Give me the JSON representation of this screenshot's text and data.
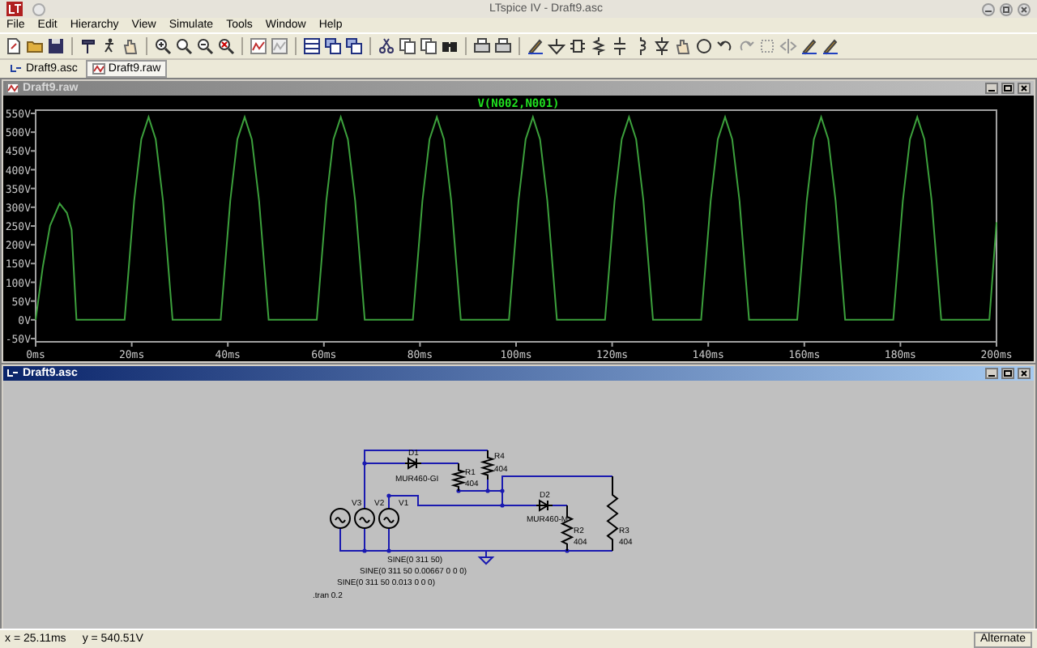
{
  "window": {
    "title": "LTspice IV - Draft9.asc"
  },
  "menu": [
    "File",
    "Edit",
    "Hierarchy",
    "View",
    "Simulate",
    "Tools",
    "Window",
    "Help"
  ],
  "tabs": [
    {
      "label": "Draft9.asc",
      "selected": false
    },
    {
      "label": "Draft9.raw",
      "selected": true
    }
  ],
  "waveform_window": {
    "title": "Draft9.raw",
    "active": false,
    "chart_data": {
      "type": "line",
      "xlim": [
        0,
        200
      ],
      "ylim": [
        -50,
        550
      ],
      "xticks": [
        {
          "value": 0,
          "label": "0ms"
        },
        {
          "value": 20,
          "label": "20ms"
        },
        {
          "value": 40,
          "label": "40ms"
        },
        {
          "value": 60,
          "label": "60ms"
        },
        {
          "value": 80,
          "label": "80ms"
        },
        {
          "value": 100,
          "label": "100ms"
        },
        {
          "value": 120,
          "label": "120ms"
        },
        {
          "value": 140,
          "label": "140ms"
        },
        {
          "value": 160,
          "label": "160ms"
        },
        {
          "value": 180,
          "label": "180ms"
        },
        {
          "value": 200,
          "label": "200ms"
        }
      ],
      "yticks": [
        {
          "value": -50,
          "label": "-50V"
        },
        {
          "value": 0,
          "label": "0V"
        },
        {
          "value": 50,
          "label": "50V"
        },
        {
          "value": 100,
          "label": "100V"
        },
        {
          "value": 150,
          "label": "150V"
        },
        {
          "value": 200,
          "label": "200V"
        },
        {
          "value": 250,
          "label": "250V"
        },
        {
          "value": 300,
          "label": "300V"
        },
        {
          "value": 350,
          "label": "350V"
        },
        {
          "value": 400,
          "label": "400V"
        },
        {
          "value": 450,
          "label": "450V"
        },
        {
          "value": 500,
          "label": "500V"
        },
        {
          "value": 550,
          "label": "550V"
        }
      ],
      "x": [
        0,
        1.5,
        3,
        5,
        6.5,
        7.5,
        8.5,
        18.5,
        20.5,
        22,
        23.5,
        25,
        26.5,
        28.5,
        38.5,
        40.5,
        42,
        43.5,
        45,
        46.5,
        48.5,
        58.5,
        60.5,
        62,
        63.5,
        65,
        66.5,
        68.5,
        78.5,
        80.5,
        82,
        83.5,
        85,
        86.5,
        88.5,
        98.5,
        100.5,
        102,
        103.5,
        105,
        106.5,
        108.5,
        118.5,
        120.5,
        122,
        123.5,
        125,
        126.5,
        128.5,
        138.5,
        140.5,
        142,
        143.5,
        145,
        146.5,
        148.5,
        158.5,
        160.5,
        162,
        163.5,
        165,
        166.5,
        168.5,
        178.5,
        180.5,
        182,
        183.5,
        185,
        186.5,
        188.5,
        198.5,
        200
      ],
      "series": [
        {
          "name": "V(N002,N001)",
          "color": "#3ca03c",
          "values": [
            0,
            141,
            251,
            310,
            285,
            240,
            0,
            0,
            317,
            481,
            540,
            481,
            317,
            0,
            0,
            317,
            481,
            540,
            481,
            317,
            0,
            0,
            317,
            481,
            540,
            481,
            317,
            0,
            0,
            317,
            481,
            540,
            481,
            317,
            0,
            0,
            317,
            481,
            540,
            481,
            317,
            0,
            0,
            317,
            481,
            540,
            481,
            317,
            0,
            0,
            317,
            481,
            540,
            481,
            317,
            0,
            0,
            317,
            481,
            540,
            481,
            317,
            0,
            0,
            317,
            481,
            540,
            481,
            317,
            0,
            0,
            260
          ]
        }
      ]
    }
  },
  "schematic_window": {
    "title": "Draft9.asc",
    "active": true,
    "components": [
      {
        "kind": "voltage_source",
        "label": "V3"
      },
      {
        "kind": "voltage_source",
        "label": "V2"
      },
      {
        "kind": "voltage_source",
        "label": "V1"
      },
      {
        "kind": "diode",
        "label": "D1",
        "value": "MUR460-GI"
      },
      {
        "kind": "resistor",
        "label": "R4",
        "value": "404"
      },
      {
        "kind": "resistor",
        "label": "R1",
        "value": "404"
      },
      {
        "kind": "diode",
        "label": "D2",
        "value": "MUR460-M"
      },
      {
        "kind": "resistor",
        "label": "R2",
        "value": "404"
      },
      {
        "kind": "resistor",
        "label": "R3",
        "value": "404"
      }
    ],
    "directives": [
      "SINE(0 311 50)",
      "SINE(0 311 50 0.00667 0 0 0)",
      "SINE(0 311 50 0.013 0 0 0)",
      ".tran 0.2"
    ]
  },
  "status_bar": {
    "x": "x = 25.11ms",
    "y": "y = 540.51V",
    "mode": "Alternate"
  }
}
